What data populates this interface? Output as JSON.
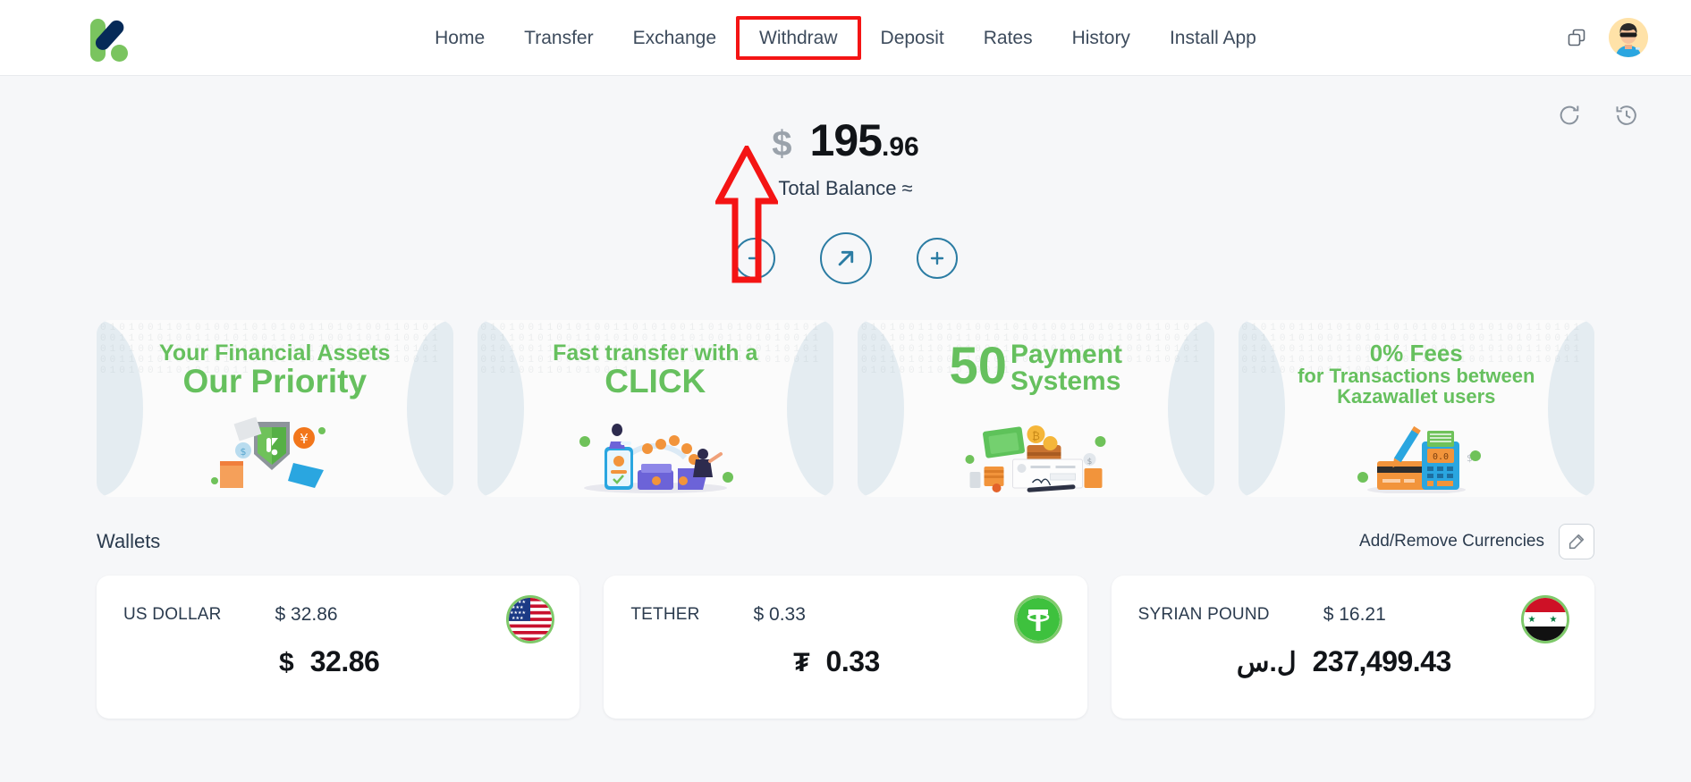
{
  "brand": {
    "name": "Kazawallet",
    "logo_colors": {
      "green": "#7ac45f",
      "navy": "#062a58"
    }
  },
  "nav": {
    "items": [
      {
        "label": "Home",
        "annotated": false
      },
      {
        "label": "Transfer",
        "annotated": false
      },
      {
        "label": "Exchange",
        "annotated": false
      },
      {
        "label": "Withdraw",
        "annotated": true
      },
      {
        "label": "Deposit",
        "annotated": false
      },
      {
        "label": "Rates",
        "annotated": false
      },
      {
        "label": "History",
        "annotated": false
      },
      {
        "label": "Install App",
        "annotated": false
      }
    ],
    "copy_icon": "copy-icon",
    "avatar_icon": "user-avatar"
  },
  "annotation": {
    "color": "#f41414",
    "target": "Withdraw",
    "shape": "up-arrow"
  },
  "top_tools": [
    {
      "name": "refresh-icon"
    },
    {
      "name": "history-clock-icon"
    }
  ],
  "balance": {
    "currency_symbol": "$",
    "integer": "195",
    "decimal": ".96",
    "label": "Total Balance ≈"
  },
  "actions": [
    {
      "name": "withdraw-action",
      "icon": "minus-circle-icon"
    },
    {
      "name": "transfer-action",
      "icon": "arrow-up-right-circle-icon"
    },
    {
      "name": "deposit-action",
      "icon": "plus-circle-icon"
    }
  ],
  "banners": [
    {
      "line1": "Your Financial Assets",
      "line2": "Our Priority",
      "illustration": "shield-assets-illustration"
    },
    {
      "line1": "Fast transfer with a",
      "line2": "CLICK",
      "illustration": "fast-transfer-illustration"
    },
    {
      "number": "50",
      "stack1": "Payment",
      "stack2": "Systems",
      "illustration": "payment-systems-illustration"
    },
    {
      "line1": "0% Fees",
      "line2": "for Transactions between",
      "line3": "Kazawallet users",
      "illustration": "zero-fees-illustration"
    }
  ],
  "wallets_section": {
    "title": "Wallets",
    "add_remove_label": "Add/Remove Currencies",
    "edit_icon": "edit-pencil-icon"
  },
  "wallets": [
    {
      "name": "US DOLLAR",
      "usd_value": "$ 32.86",
      "symbol": "$",
      "amount": "32.86",
      "flag": "us-flag-icon"
    },
    {
      "name": "TETHER",
      "usd_value": "$ 0.33",
      "symbol": "₮",
      "amount": "0.33",
      "flag": "tether-icon"
    },
    {
      "name": "SYRIAN POUND",
      "usd_value": "$ 16.21",
      "symbol": "ل.س",
      "amount": "237,499.43",
      "flag": "syria-flag-icon"
    }
  ],
  "colors": {
    "page_bg": "#f6f7f9",
    "accent_green": "#66c05e",
    "action_blue": "#2b7ca3",
    "annotation_red": "#f41414",
    "text_dark": "#2b3b4e"
  }
}
